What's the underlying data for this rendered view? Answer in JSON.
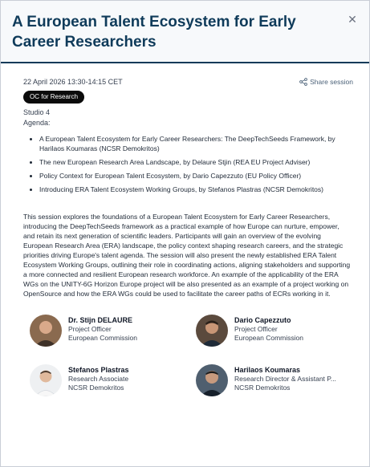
{
  "modal": {
    "title": "A European Talent Ecosystem for Early Career Researchers",
    "close_icon": "close-icon"
  },
  "session": {
    "datetime": "22 April 2026 13:30-14:15 CET",
    "share_label": "Share session",
    "badge": "OC for Research",
    "studio": "Studio 4",
    "agenda_label": "Agenda:",
    "agenda_items": [
      "A European Talent Ecosystem for Early Career Researchers: The DeepTechSeeds Framework, by Harilaos Koumaras (NCSR Demokritos)",
      "The new European Research Area Landscape, by Delaure Stjin (REA EU Project Adviser)",
      "Policy Context for European Talent Ecosystem, by Dario Capezzuto (EU Policy Officer)",
      "Introducing ERA Talent Ecosystem Working Groups, by Stefanos Plastras (NCSR Demokritos)"
    ],
    "description": "This session explores the foundations of a European Talent Ecosystem for Early Career Researchers, introducing the DeepTechSeeds framework as a practical example of how Europe can nurture, empower, and retain its next generation of scientific leaders. Participants will gain an overview of the evolving European Research Area (ERA) landscape, the policy context shaping research careers, and the strategic priorities driving Europe's talent agenda. The session will also present the newly established ERA Talent Ecosystem Working Groups, outlining their role in coordinating actions, aligning stakeholders and supporting a more connected and resilient European research workforce. An example of the applicability of the ERA WGs on the UNITY-6G Horizon Europe project will be also presented as an example of a project working on OpenSource and how the ERA WGs could be used to facilitate the career paths of ECRs working in it."
  },
  "speakers": [
    {
      "name": "Dr. Stijn DELAURE",
      "role": "Project Officer",
      "org": "European Commission"
    },
    {
      "name": "Dario Capezzuto",
      "role": "Project Officer",
      "org": "European Commission"
    },
    {
      "name": "Stefanos Plastras",
      "role": "Research Associate",
      "org": "NCSR Demokritos"
    },
    {
      "name": "Harilaos Koumaras",
      "role": "Research Director & Assistant P...",
      "org": "NCSR Demokritos"
    }
  ]
}
